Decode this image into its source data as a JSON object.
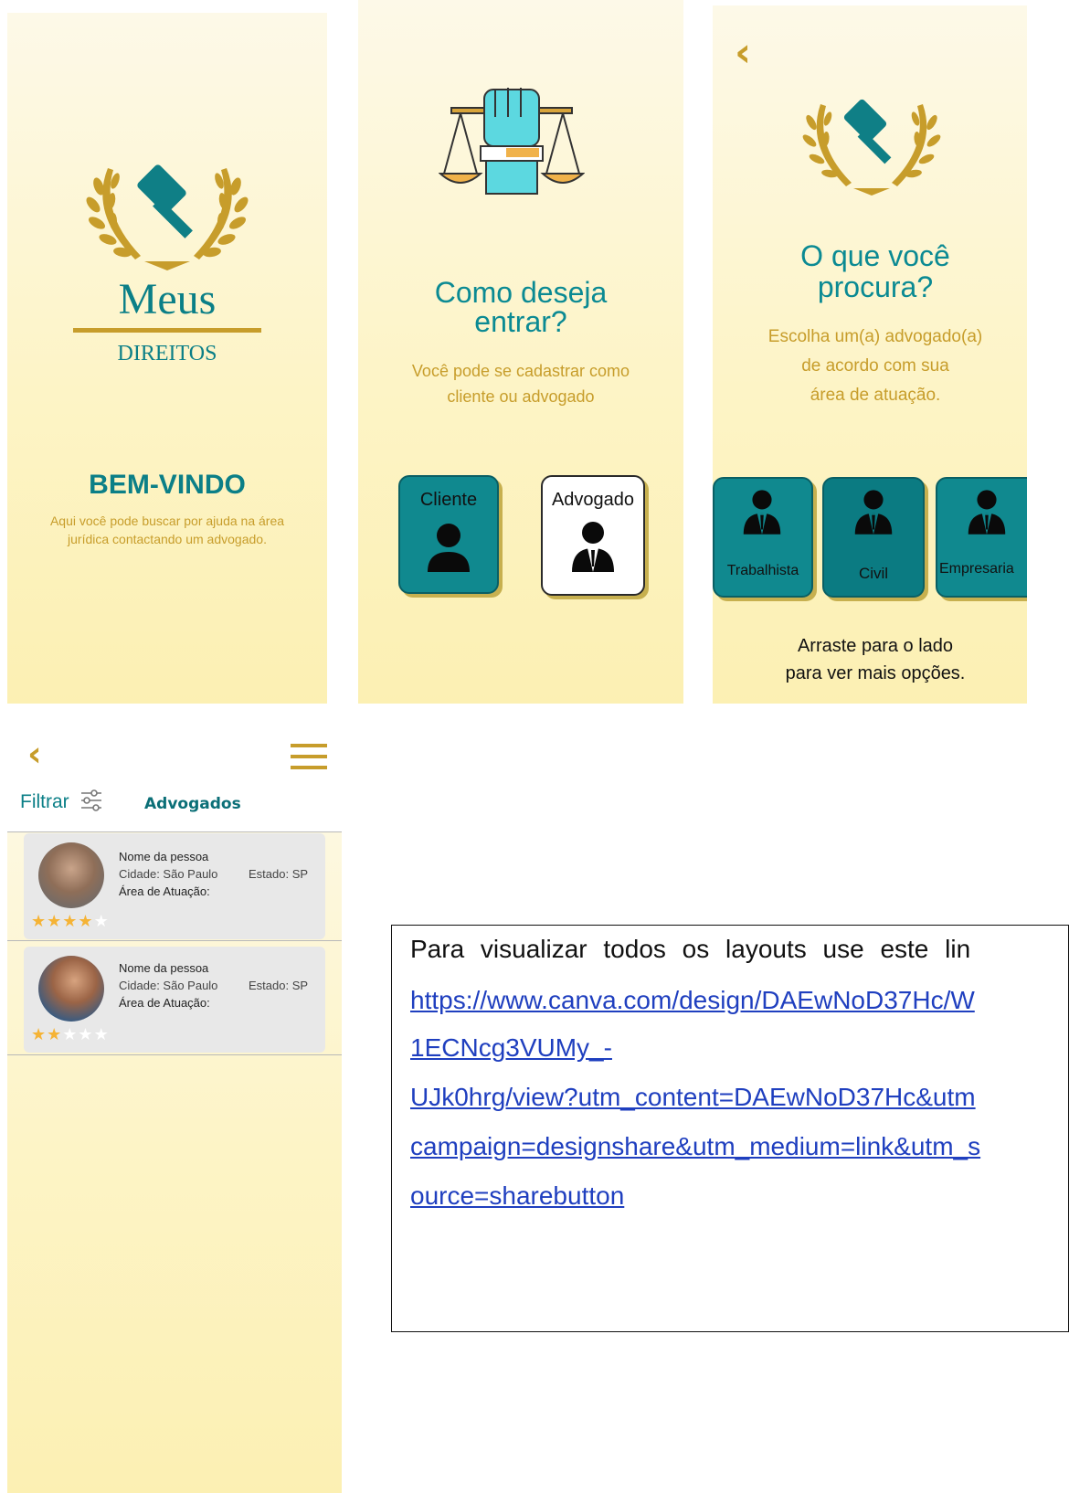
{
  "screen1": {
    "logo_title": "Meus",
    "logo_subtitle": "DIREITOS",
    "welcome_title": "BEM-VINDO",
    "welcome_text_1": "Aqui você pode buscar por ajuda na área",
    "welcome_text_2": "jurídica contactando um advogado."
  },
  "screen2": {
    "title_1": "Como deseja",
    "title_2": "entrar?",
    "subtitle_1": "Você pode se cadastrar como",
    "subtitle_2": "cliente ou advogado",
    "buttons": [
      {
        "label": "Cliente"
      },
      {
        "label": "Advogado"
      }
    ]
  },
  "screen3": {
    "back_label": "‹",
    "title_1": "O que você",
    "title_2": "procura?",
    "subtitle_1": "Escolha um(a) advogado(a)",
    "subtitle_2": "de acordo com sua",
    "subtitle_3": "área de atuação.",
    "categories": [
      {
        "label": "Trabalhista"
      },
      {
        "label": "Civil"
      },
      {
        "label": "Empresaria"
      }
    ],
    "hint_1": "Arraste para o lado",
    "hint_2": "para ver mais opções."
  },
  "screen4": {
    "back_label": "‹",
    "filter_label": "Filtrar",
    "tab_label": "Advogados",
    "lawyers": [
      {
        "name": "Nome da pessoa",
        "city": "Cidade: São Paulo",
        "state": "Estado: SP",
        "area": "Área de Atuação:",
        "rating": 4,
        "rating_max": 5
      },
      {
        "name": "Nome da pessoa",
        "city": "Cidade: São Paulo",
        "state": "Estado: SP",
        "area": "Área de Atuação:",
        "rating": 2,
        "rating_max": 5
      }
    ]
  },
  "note": {
    "text": "Para visualizar todos os layouts use este lin",
    "link_lines": [
      "https://www.canva.com/design/DAEwNoD37Hc/W",
      "1ECNcg3VUMy_-",
      "UJk0hrg/view?utm_content=DAEwNoD37Hc&utm",
      "campaign=designshare&utm_medium=link&utm_s",
      "ource=sharebutton"
    ]
  },
  "colors": {
    "teal": "#0b8a93",
    "gold": "#c79d2b",
    "background": "#fdf4c6"
  }
}
